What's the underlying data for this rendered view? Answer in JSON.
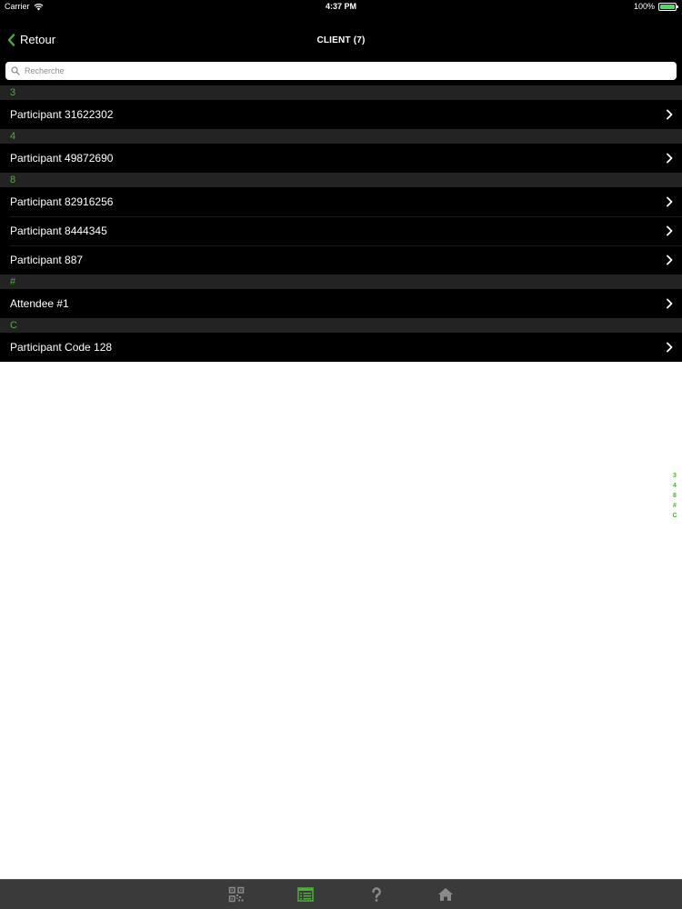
{
  "status_bar": {
    "carrier": "Carrier",
    "time": "4:37 PM",
    "battery": "100%",
    "battery_level": 1.0
  },
  "nav": {
    "back_label": "Retour",
    "title": "CLIENT (7)"
  },
  "search": {
    "placeholder": "Recherche",
    "value": ""
  },
  "sections": [
    {
      "header": "3",
      "rows": [
        "Participant 31622302"
      ]
    },
    {
      "header": "4",
      "rows": [
        "Participant 49872690"
      ]
    },
    {
      "header": "8",
      "rows": [
        "Participant 82916256",
        "Participant 8444345",
        "Participant 887"
      ]
    },
    {
      "header": "#",
      "rows": [
        "Attendee #1"
      ]
    },
    {
      "header": "C",
      "rows": [
        "Participant Code 128"
      ]
    }
  ],
  "index_bar": [
    "3",
    "4",
    "8",
    "#",
    "C"
  ],
  "tab_bar": {
    "items": [
      {
        "icon": "qr-code-icon",
        "active": false
      },
      {
        "icon": "list-icon",
        "active": true
      },
      {
        "icon": "question-icon",
        "active": false
      },
      {
        "icon": "home-icon",
        "active": false
      }
    ]
  },
  "colors": {
    "accent": "#4caf36",
    "background": "#000000",
    "section_header": "#232323",
    "tab_bar": "#3a3a3a",
    "tab_icon": "#8a8a8a"
  }
}
